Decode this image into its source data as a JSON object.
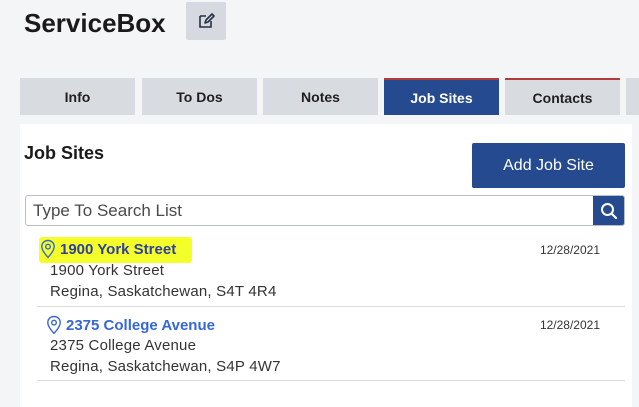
{
  "app": {
    "title": "ServiceBox"
  },
  "tabs": [
    {
      "label": "Info"
    },
    {
      "label": "To Dos"
    },
    {
      "label": "Notes"
    },
    {
      "label": "Job Sites"
    },
    {
      "label": "Contacts"
    }
  ],
  "active_tab": "Job Sites",
  "section": {
    "title": "Job Sites",
    "add_button": "Add Job Site"
  },
  "search": {
    "placeholder": "Type To Search List",
    "value": ""
  },
  "job_sites": [
    {
      "name": "1900 York Street",
      "date": "12/28/2021",
      "address_line1": "1900 York Street",
      "address_line2": "Regina, Saskatchewan, S4T 4R4",
      "highlighted": true
    },
    {
      "name": "2375 College Avenue",
      "date": "12/28/2021",
      "address_line1": "2375 College Avenue",
      "address_line2": "Regina, Saskatchewan, S4P 4W7",
      "highlighted": false
    }
  ],
  "colors": {
    "primary": "#254a8f",
    "link": "#3567d6",
    "highlight": "#f4ff2a",
    "tab_accent": "#b33a3a"
  },
  "icons": [
    "edit-icon",
    "search-icon",
    "location-pin-icon"
  ]
}
